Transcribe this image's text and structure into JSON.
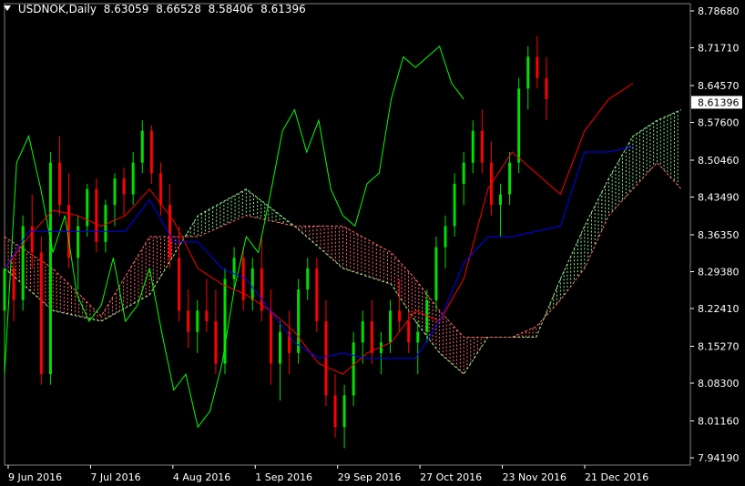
{
  "header": {
    "symbol_label": "USDNOK,Daily",
    "open": "8.63059",
    "high": "8.66528",
    "low": "8.58406",
    "close": "8.61396"
  },
  "colors": {
    "background": "#000000",
    "bull_candle": "#00e000",
    "bear_candle": "#ff0000",
    "tenkan": "#ff0000",
    "kijun": "#0000ff",
    "chikou": "#00ff00",
    "cloud_bull": "#90ee90",
    "cloud_bear": "#ff6a6a",
    "current_price_box_bg": "#ffffff",
    "axis_text": "#ffffff"
  },
  "chart_data": {
    "type": "candlestick-ichimoku",
    "x_tick_labels": [
      "9 Jun 2016",
      "7 Jul 2016",
      "4 Aug 2016",
      "1 Sep 2016",
      "29 Sep 2016",
      "27 Oct 2016",
      "23 Nov 2016",
      "21 Dec 2016"
    ],
    "y_tick_labels": [
      "8.78680",
      "8.71710",
      "8.64570",
      "8.57600",
      "8.50460",
      "8.43490",
      "8.36350",
      "8.29380",
      "8.22410",
      "8.15270",
      "8.08300",
      "8.01160",
      "7.94190"
    ],
    "y_ticks": [
      8.7868,
      8.7171,
      8.6457,
      8.576,
      8.5046,
      8.4349,
      8.3635,
      8.2938,
      8.2241,
      8.1527,
      8.083,
      8.0116,
      7.9419
    ],
    "ylim": [
      7.9419,
      8.7868
    ],
    "current_price": "8.61396",
    "tenkan": [
      [
        0,
        8.3
      ],
      [
        10,
        8.36
      ],
      [
        20,
        8.41
      ],
      [
        30,
        8.4
      ],
      [
        40,
        8.38
      ],
      [
        50,
        8.4
      ],
      [
        60,
        8.45
      ],
      [
        70,
        8.39
      ],
      [
        80,
        8.3
      ],
      [
        90,
        8.27
      ],
      [
        100,
        8.25
      ],
      [
        110,
        8.22
      ],
      [
        120,
        8.18
      ],
      [
        130,
        8.12
      ],
      [
        140,
        8.1
      ],
      [
        150,
        8.14
      ],
      [
        160,
        8.16
      ],
      [
        170,
        8.22
      ],
      [
        180,
        8.2
      ],
      [
        190,
        8.28
      ],
      [
        200,
        8.45
      ],
      [
        210,
        8.52
      ],
      [
        220,
        8.48
      ],
      [
        230,
        8.44
      ],
      [
        240,
        8.56
      ],
      [
        250,
        8.62
      ],
      [
        260,
        8.65
      ]
    ],
    "kijun": [
      [
        0,
        8.3
      ],
      [
        10,
        8.37
      ],
      [
        20,
        8.37
      ],
      [
        30,
        8.37
      ],
      [
        40,
        8.37
      ],
      [
        50,
        8.37
      ],
      [
        60,
        8.43
      ],
      [
        70,
        8.35
      ],
      [
        80,
        8.35
      ],
      [
        90,
        8.3
      ],
      [
        100,
        8.28
      ],
      [
        110,
        8.22
      ],
      [
        120,
        8.16
      ],
      [
        130,
        8.13
      ],
      [
        140,
        8.14
      ],
      [
        150,
        8.13
      ],
      [
        160,
        8.13
      ],
      [
        170,
        8.13
      ],
      [
        180,
        8.2
      ],
      [
        190,
        8.31
      ],
      [
        200,
        8.36
      ],
      [
        210,
        8.36
      ],
      [
        220,
        8.37
      ],
      [
        230,
        8.38
      ],
      [
        240,
        8.52
      ],
      [
        250,
        8.52
      ],
      [
        260,
        8.53
      ]
    ],
    "chikou": [
      [
        0,
        8.1
      ],
      [
        5,
        8.5
      ],
      [
        10,
        8.55
      ],
      [
        15,
        8.45
      ],
      [
        20,
        8.33
      ],
      [
        25,
        8.4
      ],
      [
        30,
        8.25
      ],
      [
        35,
        8.2
      ],
      [
        40,
        8.23
      ],
      [
        45,
        8.32
      ],
      [
        50,
        8.2
      ],
      [
        55,
        8.23
      ],
      [
        60,
        8.3
      ],
      [
        65,
        8.18
      ],
      [
        70,
        8.07
      ],
      [
        75,
        8.1
      ],
      [
        80,
        8.0
      ],
      [
        85,
        8.03
      ],
      [
        90,
        8.12
      ],
      [
        95,
        8.26
      ],
      [
        100,
        8.36
      ],
      [
        105,
        8.33
      ],
      [
        110,
        8.44
      ],
      [
        115,
        8.56
      ],
      [
        120,
        8.6
      ],
      [
        125,
        8.52
      ],
      [
        130,
        8.58
      ],
      [
        135,
        8.45
      ],
      [
        140,
        8.4
      ],
      [
        145,
        8.38
      ],
      [
        150,
        8.46
      ],
      [
        155,
        8.48
      ],
      [
        160,
        8.62
      ],
      [
        165,
        8.7
      ],
      [
        170,
        8.68
      ],
      [
        175,
        8.7
      ],
      [
        180,
        8.72
      ],
      [
        185,
        8.65
      ],
      [
        190,
        8.62
      ]
    ],
    "senkou_a": [
      [
        0,
        8.3
      ],
      [
        20,
        8.22
      ],
      [
        40,
        8.2
      ],
      [
        60,
        8.25
      ],
      [
        80,
        8.4
      ],
      [
        100,
        8.45
      ],
      [
        120,
        8.38
      ],
      [
        140,
        8.3
      ],
      [
        160,
        8.27
      ],
      [
        170,
        8.2
      ],
      [
        180,
        8.14
      ],
      [
        190,
        8.1
      ],
      [
        200,
        8.17
      ],
      [
        210,
        8.17
      ],
      [
        220,
        8.17
      ],
      [
        230,
        8.28
      ],
      [
        240,
        8.38
      ],
      [
        250,
        8.47
      ],
      [
        260,
        8.55
      ],
      [
        270,
        8.58
      ],
      [
        280,
        8.6
      ]
    ],
    "senkou_b": [
      [
        0,
        8.36
      ],
      [
        20,
        8.3
      ],
      [
        40,
        8.21
      ],
      [
        60,
        8.36
      ],
      [
        80,
        8.36
      ],
      [
        100,
        8.4
      ],
      [
        120,
        8.38
      ],
      [
        140,
        8.38
      ],
      [
        160,
        8.33
      ],
      [
        170,
        8.28
      ],
      [
        180,
        8.22
      ],
      [
        190,
        8.17
      ],
      [
        200,
        8.17
      ],
      [
        210,
        8.17
      ],
      [
        220,
        8.19
      ],
      [
        230,
        8.24
      ],
      [
        240,
        8.3
      ],
      [
        250,
        8.4
      ],
      [
        260,
        8.45
      ],
      [
        270,
        8.5
      ],
      [
        280,
        8.45
      ]
    ],
    "candles": [
      [
        0,
        8.22,
        8.28,
        8.12,
        8.3
      ],
      [
        2,
        8.3,
        8.32,
        8.2,
        8.24
      ],
      [
        4,
        8.24,
        8.4,
        8.22,
        8.38
      ],
      [
        6,
        8.38,
        8.44,
        8.3,
        8.33
      ],
      [
        8,
        8.33,
        8.36,
        8.08,
        8.1
      ],
      [
        10,
        8.1,
        8.52,
        8.08,
        8.5
      ],
      [
        12,
        8.5,
        8.55,
        8.4,
        8.42
      ],
      [
        14,
        8.42,
        8.48,
        8.3,
        8.32
      ],
      [
        16,
        8.32,
        8.4,
        8.26,
        8.38
      ],
      [
        18,
        8.38,
        8.46,
        8.36,
        8.45
      ],
      [
        20,
        8.45,
        8.47,
        8.33,
        8.35
      ],
      [
        22,
        8.35,
        8.43,
        8.33,
        8.42
      ],
      [
        24,
        8.42,
        8.48,
        8.38,
        8.47
      ],
      [
        26,
        8.47,
        8.49,
        8.4,
        8.44
      ],
      [
        28,
        8.44,
        8.52,
        8.42,
        8.5
      ],
      [
        30,
        8.5,
        8.58,
        8.48,
        8.56
      ],
      [
        32,
        8.56,
        8.57,
        8.46,
        8.48
      ],
      [
        34,
        8.48,
        8.5,
        8.4,
        8.42
      ],
      [
        36,
        8.42,
        8.46,
        8.3,
        8.32
      ],
      [
        38,
        8.32,
        8.38,
        8.2,
        8.22
      ],
      [
        40,
        8.22,
        8.26,
        8.15,
        8.18
      ],
      [
        42,
        8.18,
        8.24,
        8.14,
        8.22
      ],
      [
        44,
        8.22,
        8.28,
        8.18,
        8.2
      ],
      [
        46,
        8.2,
        8.26,
        8.1,
        8.12
      ],
      [
        48,
        8.12,
        8.3,
        8.1,
        8.28
      ],
      [
        50,
        8.28,
        8.34,
        8.26,
        8.32
      ],
      [
        52,
        8.32,
        8.34,
        8.22,
        8.24
      ],
      [
        54,
        8.24,
        8.32,
        8.22,
        8.3
      ],
      [
        56,
        8.3,
        8.36,
        8.2,
        8.22
      ],
      [
        58,
        8.22,
        8.26,
        8.08,
        8.12
      ],
      [
        60,
        8.12,
        8.2,
        8.05,
        8.18
      ],
      [
        62,
        8.18,
        8.22,
        8.1,
        8.14
      ],
      [
        64,
        8.14,
        8.28,
        8.12,
        8.26
      ],
      [
        66,
        8.26,
        8.32,
        8.24,
        8.3
      ],
      [
        68,
        8.3,
        8.32,
        8.18,
        8.2
      ],
      [
        70,
        8.2,
        8.24,
        8.04,
        8.06
      ],
      [
        72,
        8.06,
        8.1,
        7.98,
        8.0
      ],
      [
        74,
        8.0,
        8.08,
        7.96,
        8.06
      ],
      [
        76,
        8.06,
        8.18,
        8.04,
        8.16
      ],
      [
        78,
        8.16,
        8.22,
        8.12,
        8.2
      ],
      [
        80,
        8.2,
        8.24,
        8.12,
        8.14
      ],
      [
        82,
        8.14,
        8.18,
        8.1,
        8.16
      ],
      [
        84,
        8.16,
        8.24,
        8.14,
        8.22
      ],
      [
        86,
        8.22,
        8.28,
        8.18,
        8.2
      ],
      [
        88,
        8.2,
        8.22,
        8.14,
        8.16
      ],
      [
        90,
        8.16,
        8.2,
        8.1,
        8.18
      ],
      [
        92,
        8.18,
        8.26,
        8.16,
        8.24
      ],
      [
        94,
        8.24,
        8.36,
        8.22,
        8.34
      ],
      [
        96,
        8.34,
        8.4,
        8.3,
        8.38
      ],
      [
        98,
        8.38,
        8.48,
        8.36,
        8.46
      ],
      [
        100,
        8.46,
        8.52,
        8.42,
        8.5
      ],
      [
        102,
        8.5,
        8.58,
        8.48,
        8.56
      ],
      [
        104,
        8.56,
        8.6,
        8.48,
        8.5
      ],
      [
        106,
        8.5,
        8.54,
        8.4,
        8.42
      ],
      [
        108,
        8.42,
        8.46,
        8.36,
        8.44
      ],
      [
        110,
        8.44,
        8.52,
        8.42,
        8.5
      ],
      [
        112,
        8.5,
        8.66,
        8.48,
        8.64
      ],
      [
        114,
        8.64,
        8.72,
        8.6,
        8.7
      ],
      [
        116,
        8.7,
        8.74,
        8.64,
        8.66
      ],
      [
        118,
        8.66,
        8.7,
        8.58,
        8.62
      ]
    ]
  }
}
